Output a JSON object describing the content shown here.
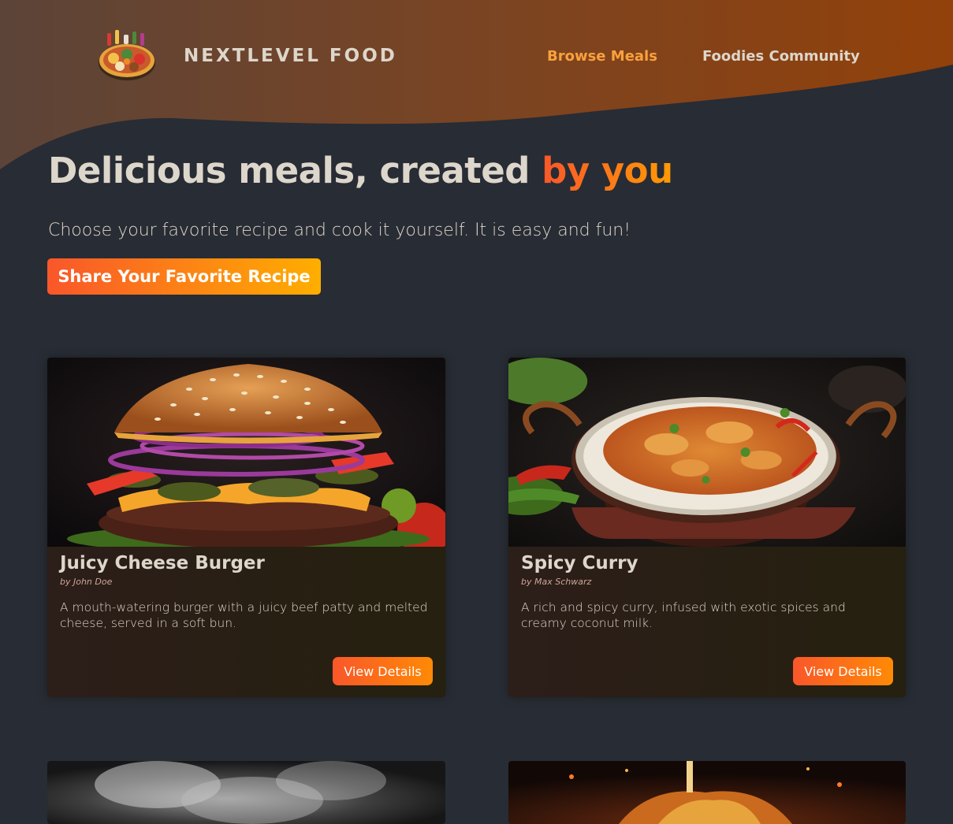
{
  "brand": {
    "name": "NEXTLEVEL FOOD",
    "logo_icon": "food-platter-logo"
  },
  "nav": {
    "items": [
      {
        "label": "Browse Meals",
        "active": true
      },
      {
        "label": "Foodies Community",
        "active": false
      }
    ]
  },
  "hero": {
    "title_main": "Delicious meals, created ",
    "title_highlight": "by you",
    "subtitle": "Choose your favorite recipe and cook it yourself. It is easy and fun!",
    "cta_label": "Share Your Favorite Recipe"
  },
  "meals": [
    {
      "title": "Juicy Cheese Burger",
      "author": "by John Doe",
      "summary": "A mouth-watering burger with a juicy beef patty and melted cheese, served in a soft bun.",
      "button": "View Details",
      "image": "burger-photo"
    },
    {
      "title": "Spicy Curry",
      "author": "by Max Schwarz",
      "summary": "A rich and spicy curry, infused with exotic spices and creamy coconut milk.",
      "button": "View Details",
      "image": "curry-photo"
    }
  ],
  "colors": {
    "background": "#282c34",
    "accent_start": "#f9572a",
    "accent_end": "#ff9b05",
    "nav_active": "#f9a13c"
  }
}
